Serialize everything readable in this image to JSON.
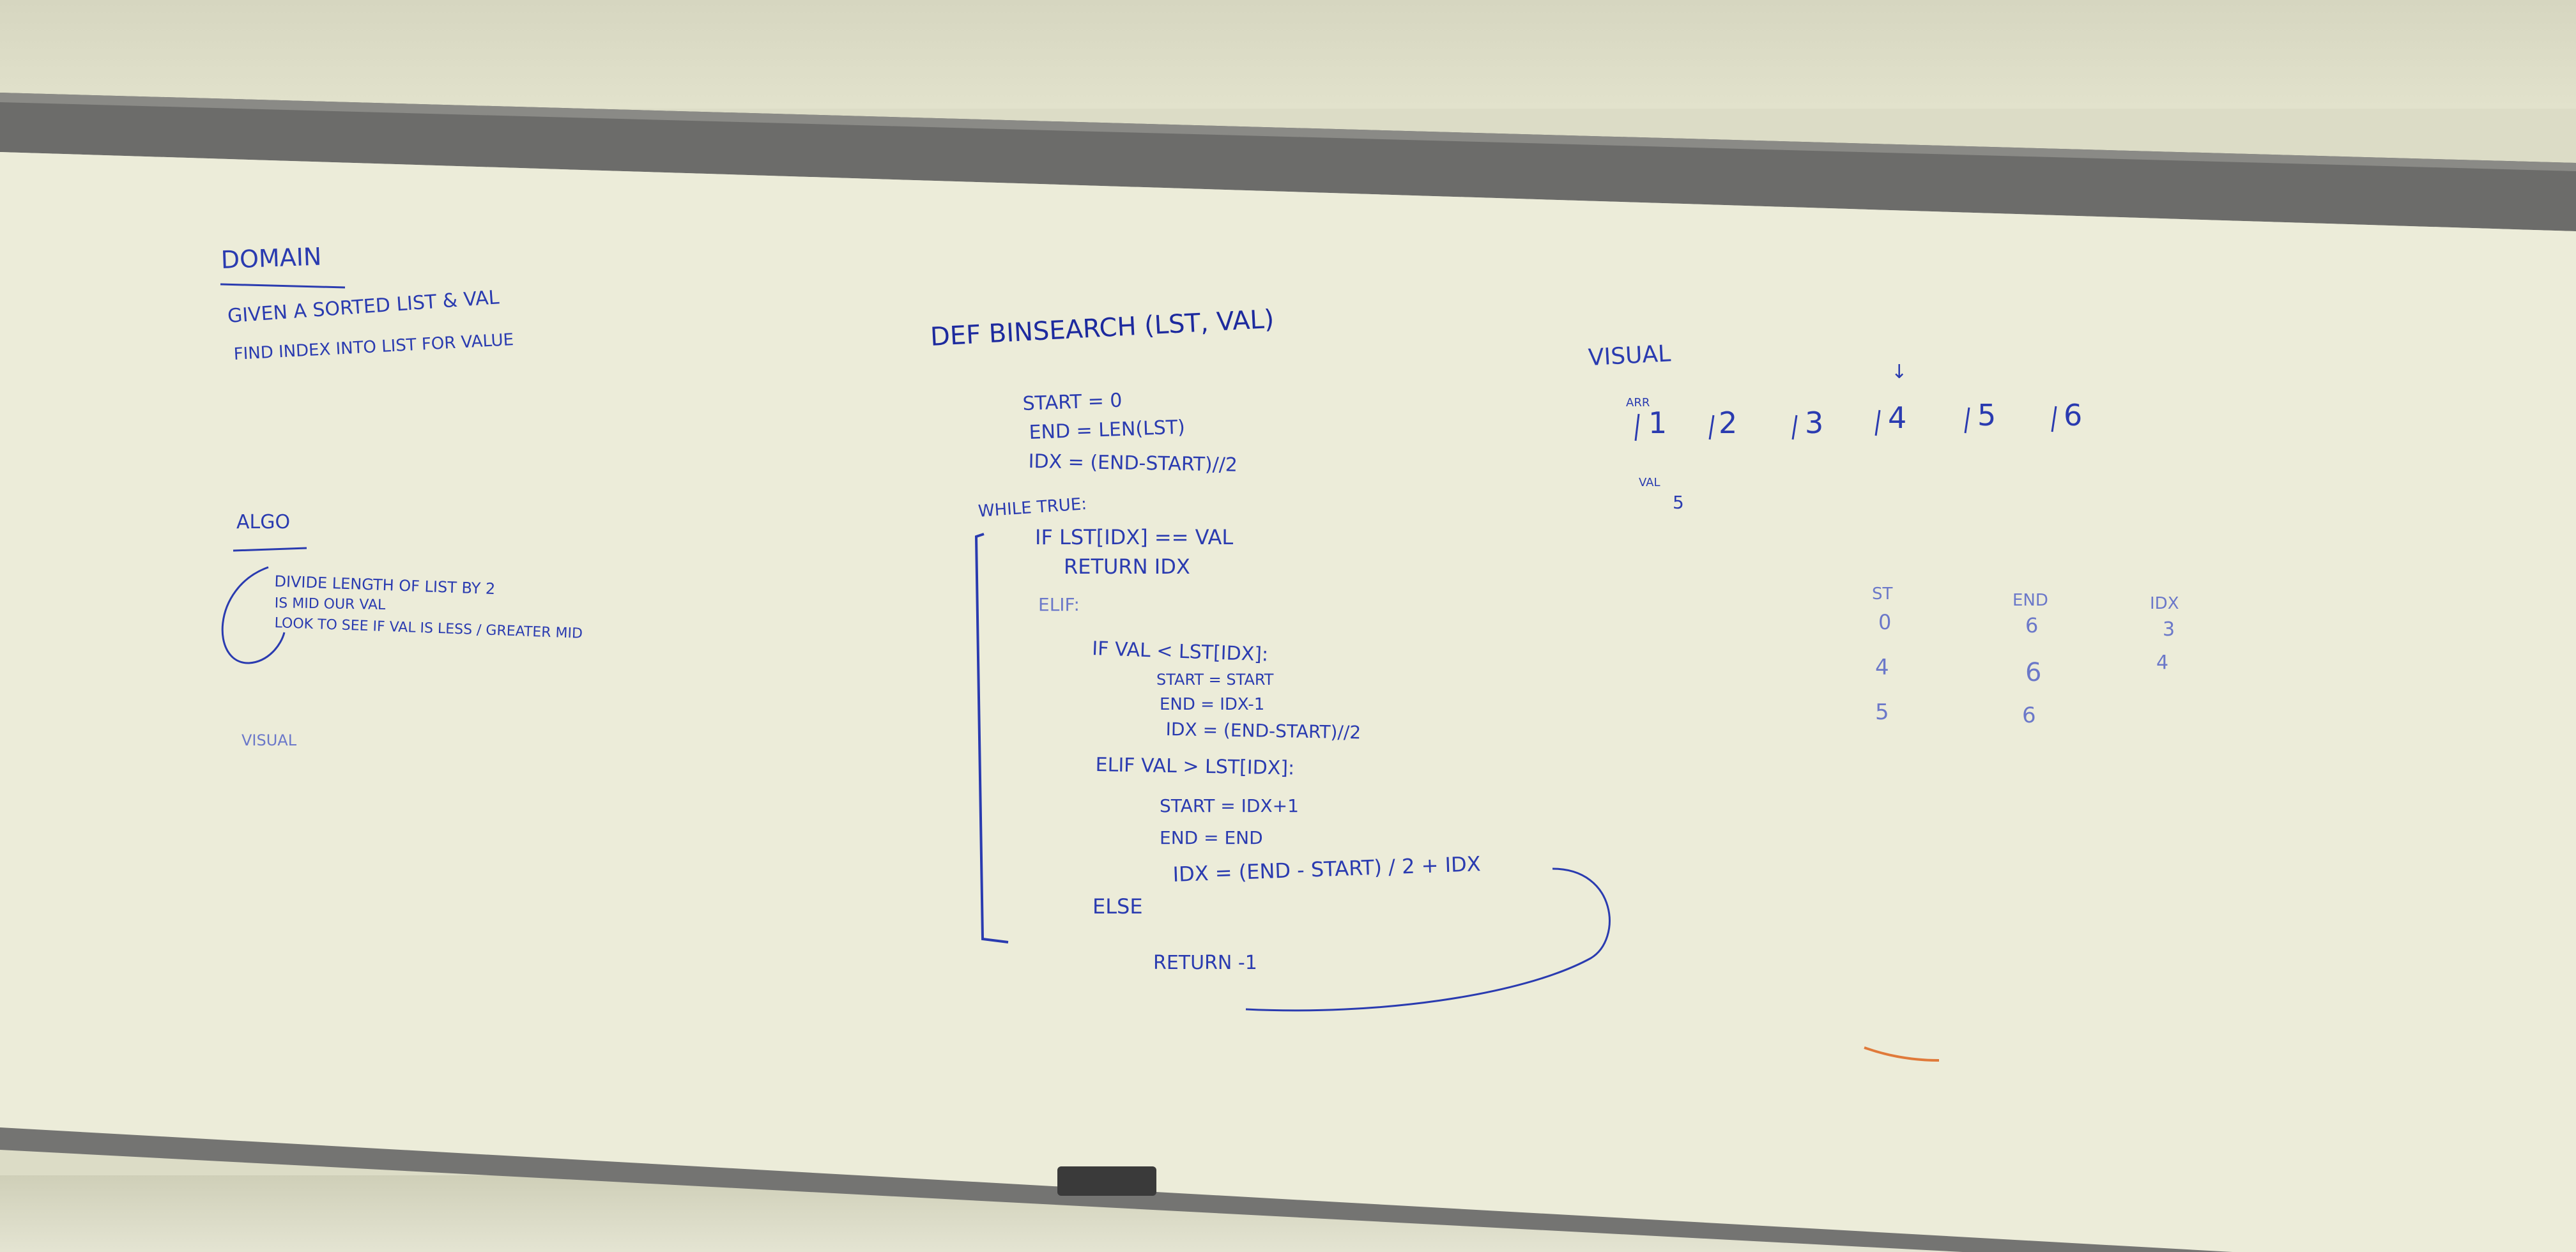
{
  "left_column": {
    "heading": "DOMAIN",
    "line1": "GIVEN A SORTED LIST & VAL",
    "line2": "FIND INDEX INTO LIST FOR VALUE",
    "algo_heading": "ALGO",
    "algo_step1": "DIVIDE LENGTH OF LIST BY 2",
    "algo_step2": "IS MID OUR VAL",
    "algo_step3": "LOOK TO SEE IF VAL IS LESS / GREATER MID",
    "visual_label": "VISUAL"
  },
  "code": {
    "def_line": "DEF BINSEARCH (LST, VAL)",
    "start_init": "START = 0",
    "end_init": "END = LEN(LST)",
    "idx_init": "IDX = (END-START)//2",
    "while_line": "WHILE TRUE:",
    "if_line": "IF LST[IDX] == VAL",
    "return_idx": "RETURN IDX",
    "elif_line": "ELIF:",
    "if_less": "IF VAL < LST[IDX]:",
    "start_keep": "START = START",
    "end_dec": "END = IDX-1",
    "idx_mid1": "IDX = (END-START)//2",
    "elif_greater": "ELIF VAL > LST[IDX]:",
    "start_inc": "START = IDX+1",
    "end_keep": "END = END",
    "idx_mid2": "IDX = (END - START) / 2 + IDX",
    "else_line": "ELSE",
    "return_neg": "RETURN -1"
  },
  "visual": {
    "heading": "VISUAL",
    "arr_label": "ARR",
    "array": [
      "1",
      "2",
      "3",
      "4",
      "5",
      "6"
    ],
    "pointer": "↓",
    "val_label": "VAL",
    "val_value": "5",
    "table_headers": [
      "ST",
      "END",
      "IDX"
    ],
    "table_rows": [
      [
        "0",
        "6",
        "3"
      ],
      [
        "4",
        "6",
        "4"
      ],
      [
        "5",
        "6",
        ""
      ]
    ]
  },
  "colors": {
    "marker_blue": "#2a3bb0",
    "board_white": "#ececda",
    "frame_gray": "#6e6e6c",
    "orange_mark": "#e07a3a"
  }
}
